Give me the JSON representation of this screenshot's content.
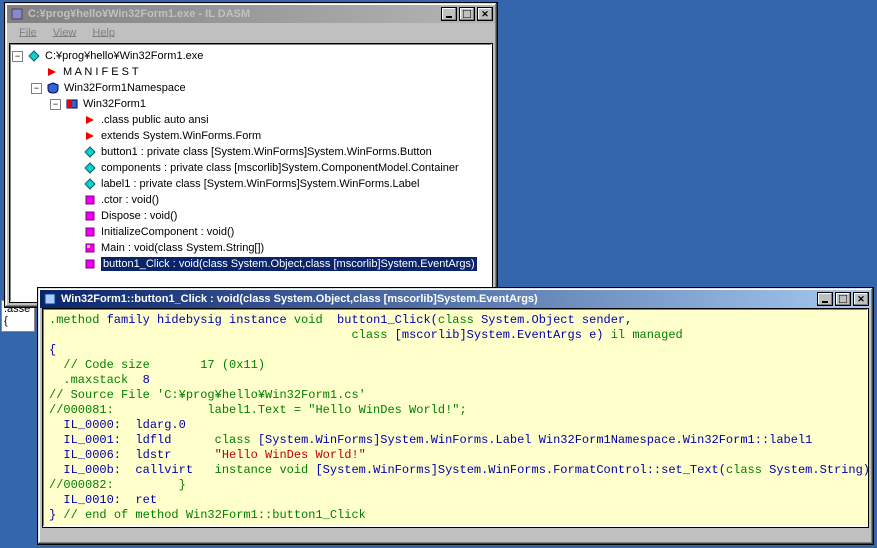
{
  "win1": {
    "title": "C:¥prog¥hello¥Win32Form1.exe - IL DASM",
    "menu": {
      "file": "File",
      "view": "View",
      "help": "Help"
    },
    "tree": {
      "root": "C:¥prog¥hello¥Win32Form1.exe",
      "manifest": "M A N I F E S T",
      "namespace": "Win32Form1Namespace",
      "classname": "Win32Form1",
      "n1": ".class public auto ansi",
      "n2": "extends System.WinForms.Form",
      "n3": "button1 : private class [System.WinForms]System.WinForms.Button",
      "n4": "components : private class [mscorlib]System.ComponentModel.Container",
      "n5": "label1 : private class [System.WinForms]System.WinForms.Label",
      "n6": ".ctor : void()",
      "n7": "Dispose : void()",
      "n8": "InitializeComponent : void()",
      "n9": "Main : void(class System.String[])",
      "n10": "button1_Click : void(class System.Object,class [mscorlib]System.EventArgs)"
    }
  },
  "win2": {
    "title": "Win32Form1::button1_Click : void(class System.Object,class [mscorlib]System.EventArgs)",
    "l1a": ".method ",
    "l1b": "family hidebysig instance ",
    "l1c": "void",
    "l1d": "  button1_Click(",
    "l1e": "class ",
    "l1f": "System.Object sender,",
    "l2a": "                                          ",
    "l2b": "class ",
    "l2c": "[mscorlib]System.EventArgs e) ",
    "l2d": "il managed",
    "l3": "{",
    "l4": "  // Code size       17 (0x11)",
    "l5a": "  .maxstack  ",
    "l5b": "8",
    "l6": "// Source File 'C:¥prog¥hello¥Win32Form1.cs' ",
    "l7": "//000081:             label1.Text = \"Hello WinDes World!\";",
    "l8a": "  IL_0000:  ldarg.0",
    "l9a": "  IL_0001:  ldfld      ",
    "l9b": "class ",
    "l9c": "[System.WinForms]System.WinForms.Label Win32Form1Namespace.Win32Form1::label1",
    "l10a": "  IL_0006:  ldstr      ",
    "l10b": "\"Hello WinDes World!\"",
    "l11a": "  IL_000b:  callvirt   ",
    "l11b": "instance void ",
    "l11c": "[System.WinForms]System.WinForms.FormatControl::set_Text(",
    "l11d": "class ",
    "l11e": "System.String)",
    "l12": "//000082:         }",
    "l13": "  IL_0010:  ret",
    "l14": "} ",
    "l14b": "// end of method Win32Form1::button1_Click"
  },
  "asse": {
    "t1": ".asse",
    "t2": "{"
  }
}
